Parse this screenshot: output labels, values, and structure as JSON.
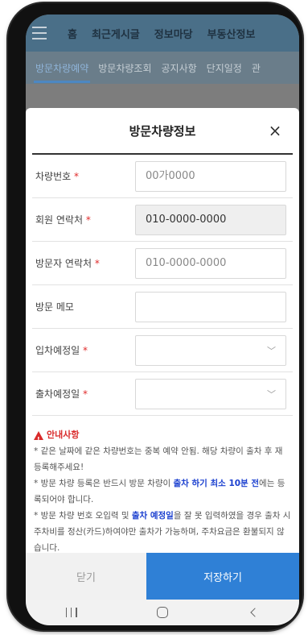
{
  "app_nav": {
    "items": [
      "홈",
      "최근게시글",
      "정보마당",
      "부동산정보"
    ]
  },
  "app_tabs": {
    "items": [
      "방문차량예약",
      "방문차량조회",
      "공지사항",
      "단지일정",
      "관"
    ]
  },
  "modal": {
    "title": "방문차량정보",
    "close_symbol": "×",
    "fields": {
      "car_number": {
        "label": "차량번호",
        "required_mark": " *",
        "placeholder": "00가0000"
      },
      "member_contact": {
        "label": "회원 연락처",
        "required_mark": " *",
        "value": "010-0000-0000"
      },
      "visitor_contact": {
        "label": "방문자 연락처",
        "required_mark": " *",
        "placeholder": "010-0000-0000"
      },
      "visit_memo": {
        "label": "방문 메모"
      },
      "entry_date": {
        "label": "입차예정일",
        "required_mark": " *"
      },
      "exit_date": {
        "label": "출차예정일",
        "required_mark": " *"
      }
    },
    "notice": {
      "title": "안내사항",
      "line1": "* 같은 날짜에 같은 차량번호는 중복 예약 안됨. 해당 차량이 출차 후 재 등록해주세요!",
      "line2_pre": "* 방문 차량 등록은 반드시 방문 차량이 ",
      "line2_hl": "출차 하기 최소 10분 전",
      "line2_post": "에는 등록되어야 합니다.",
      "line3_pre": "* 방문 차량 번호 오입력 및 ",
      "line3_hl": "출차 예정일",
      "line3_post": "을 잘 못 입력하였을 경우 출차 시 주차비를 정산(카드)하여야만 출차가 가능하며, 주차요금은 환불되지 않습니다."
    },
    "buttons": {
      "close": "닫기",
      "save": "저장하기"
    }
  },
  "colors": {
    "primary": "#2f80d6",
    "required": "#e02b2b",
    "highlight": "#1a3fcf"
  }
}
